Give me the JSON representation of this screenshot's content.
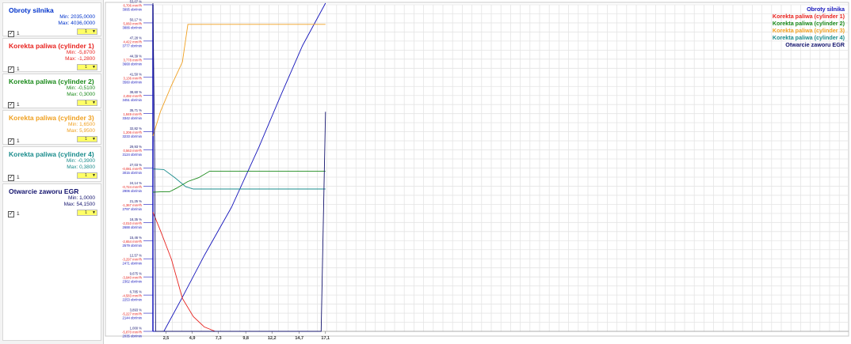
{
  "channels": [
    {
      "name": "Obroty silnika",
      "min": "Min: 2035,0000",
      "max": "Max: 4036,0000",
      "checkbox_label": "1",
      "select_value": "1",
      "color": "#0033cc"
    },
    {
      "name": "Korekta paliwa (cylinder 1)",
      "min": "Min: -5,8700",
      "max": "Max: -1,2800",
      "checkbox_label": "1",
      "select_value": "1",
      "color": "#e8231f"
    },
    {
      "name": "Korekta paliwa (cylinder 2)",
      "min": "Min: -0,5100",
      "max": "Max: 0,3000",
      "checkbox_label": "1",
      "select_value": "1",
      "color": "#1a8a1a"
    },
    {
      "name": "Korekta paliwa (cylinder 3)",
      "min": "Min: 1,6500",
      "max": "Max: 5,9500",
      "checkbox_label": "1",
      "select_value": "1",
      "color": "#f0a020"
    },
    {
      "name": "Korekta paliwa (cylinder 4)",
      "min": "Min: -0,3900",
      "max": "Max: 0,3800",
      "checkbox_label": "1",
      "select_value": "1",
      "color": "#1a8c8c"
    },
    {
      "name": "Otwarcie zaworu EGR",
      "min": "Min: 1,0000",
      "max": "Max: 54,1500",
      "checkbox_label": "1",
      "select_value": "1",
      "color": "#14146e"
    }
  ],
  "chart_data": {
    "type": "line",
    "grid": true,
    "legend_position": "top-right",
    "xlim": [
      1.3,
      65
    ],
    "x_ticks": [
      "2,5",
      "4,9",
      "7,3",
      "9,8",
      "12,2",
      "14,7",
      "17,1"
    ],
    "x_tick_values": [
      2.5,
      4.9,
      7.3,
      9.8,
      12.2,
      14.7,
      17.1
    ],
    "legend": [
      {
        "name": "Obroty silnika",
        "color": "#1515bb"
      },
      {
        "name": "Korekta paliwa (cylinder 1)",
        "color": "#e8231f"
      },
      {
        "name": "Korekta paliwa (cylinder 2)",
        "color": "#1a8a1a"
      },
      {
        "name": "Korekta paliwa (cylinder 3)",
        "color": "#f0a020"
      },
      {
        "name": "Korekta paliwa (cylinder 4)",
        "color": "#1a8c8c"
      },
      {
        "name": "Otwarcie zaworu EGR",
        "color": "#14146e"
      }
    ],
    "y_ticks": [
      {
        "pct": "53,07 %",
        "fuel": "6,706 mm³/h",
        "rpm": "3995 obr/min"
      },
      {
        "pct": "50,17 %",
        "fuel": "5,060 mm³/h",
        "rpm": "3886 obr/min"
      },
      {
        "pct": "47,28 %",
        "fuel": "4,422 mm³/h",
        "rpm": "3777 obr/min"
      },
      {
        "pct": "44,39 %",
        "fuel": "3,778 mm³/h",
        "rpm": "3668 obr/min"
      },
      {
        "pct": "41,50 %",
        "fuel": "3,136 mm³/h",
        "rpm": "3560 obr/min"
      },
      {
        "pct": "38,60 %",
        "fuel": "2,492 mm³/h",
        "rpm": "3451 obr/min"
      },
      {
        "pct": "35,71 %",
        "fuel": "1,849 mm³/h",
        "rpm": "3342 obr/min"
      },
      {
        "pct": "32,82 %",
        "fuel": "1,206 mm³/h",
        "rpm": "3233 obr/min"
      },
      {
        "pct": "29,93 %",
        "fuel": "0,563 mm³/h",
        "rpm": "3124 obr/min"
      },
      {
        "pct": "27,03 %",
        "fuel": "-0,081 mm³/h",
        "rpm": "3015 obr/min"
      },
      {
        "pct": "24,14 %",
        "fuel": "-0,724 mm³/h",
        "rpm": "2906 obr/min"
      },
      {
        "pct": "21,25 %",
        "fuel": "-1,367 mm³/h",
        "rpm": "2797 obr/min"
      },
      {
        "pct": "18,35 %",
        "fuel": "-2,010 mm³/h",
        "rpm": "2688 obr/min"
      },
      {
        "pct": "15,46 %",
        "fuel": "-2,654 mm³/h",
        "rpm": "2579 obr/min"
      },
      {
        "pct": "12,57 %",
        "fuel": "-3,297 mm³/h",
        "rpm": "2471 obr/min"
      },
      {
        "pct": "9,675 %",
        "fuel": "-3,940 mm³/h",
        "rpm": "2362 obr/min"
      },
      {
        "pct": "6,785 %",
        "fuel": "-4,583 mm³/h",
        "rpm": "2253 obr/min"
      },
      {
        "pct": "3,893 %",
        "fuel": "-5,227 mm³/h",
        "rpm": "2144 obr/min"
      },
      {
        "pct": "1,000 %",
        "fuel": "-5,870 mm³/h",
        "rpm": "2035 obr/min"
      }
    ],
    "axis_colors": {
      "pct": "#14146e",
      "fuel": "#e8231f",
      "rpm": "#1515bb"
    },
    "series": [
      {
        "name": "Obroty silnika",
        "color": "#1515bb",
        "axis": "rpm",
        "x": [
          1.3,
          2.3,
          4.0,
          6.0,
          8.5,
          11.0,
          13.0,
          15.0,
          17.1
        ],
        "y": [
          2035,
          2035,
          2240,
          2490,
          2780,
          3140,
          3450,
          3750,
          4036
        ]
      },
      {
        "name": "Korekta paliwa (cylinder 1)",
        "color": "#e8231f",
        "axis": "fuel",
        "x": [
          1.3,
          2.0,
          3.0,
          4.0,
          5.0,
          6.0,
          7.0
        ],
        "y": [
          -1.28,
          -2.0,
          -3.1,
          -4.6,
          -5.3,
          -5.7,
          -5.87
        ]
      },
      {
        "name": "Korekta paliwa (cylinder 2)",
        "color": "#1a8a1a",
        "axis": "fuel",
        "x": [
          1.3,
          2.0,
          2.8,
          3.5,
          4.5,
          5.5,
          6.5,
          17.1
        ],
        "y": [
          -0.51,
          -0.5,
          -0.5,
          -0.35,
          -0.1,
          0.05,
          0.3,
          0.3
        ]
      },
      {
        "name": "Korekta paliwa (cylinder 3)",
        "color": "#f0a020",
        "axis": "fuel",
        "x": [
          1.3,
          2.0,
          3.0,
          4.0,
          4.5,
          5.5,
          17.1
        ],
        "y": [
          1.65,
          2.6,
          3.6,
          4.5,
          5.95,
          5.95,
          5.95
        ]
      },
      {
        "name": "Korekta paliwa (cylinder 4)",
        "color": "#1a8c8c",
        "axis": "fuel",
        "x": [
          1.3,
          2.3,
          3.3,
          4.3,
          5.0,
          17.1
        ],
        "y": [
          0.38,
          0.36,
          0.05,
          -0.3,
          -0.39,
          -0.39
        ]
      },
      {
        "name": "Otwarcie zaworu EGR",
        "color": "#14146e",
        "axis": "pct",
        "x": [
          1.3,
          1.45,
          1.55,
          16.7,
          17.1
        ],
        "y": [
          54.15,
          30.0,
          1.0,
          1.0,
          36.0
        ]
      }
    ]
  }
}
